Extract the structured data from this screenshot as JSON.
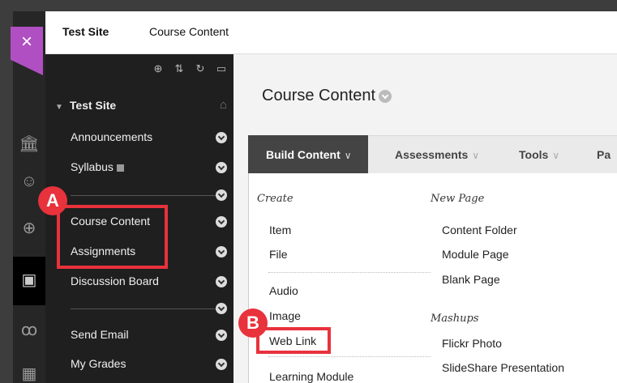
{
  "topbar": {
    "crumb_site": "Test Site",
    "crumb_page": "Course Content"
  },
  "sidebar": {
    "site_title": "Test Site",
    "items": [
      {
        "label": "Announcements"
      },
      {
        "label": "Syllabus"
      },
      {
        "label": "Course Content"
      },
      {
        "label": "Assignments"
      },
      {
        "label": "Discussion Board"
      },
      {
        "label": "Send Email"
      },
      {
        "label": "My Grades"
      }
    ]
  },
  "main": {
    "title": "Course Content",
    "actions": [
      {
        "label": "Build Content"
      },
      {
        "label": "Assessments"
      },
      {
        "label": "Tools"
      },
      {
        "label": "Pa"
      }
    ],
    "create": {
      "heading": "Create",
      "items": [
        "Item",
        "File",
        "Audio",
        "Image",
        "Web Link",
        "Learning Module"
      ]
    },
    "new_page": {
      "heading": "New Page",
      "items": [
        "Content Folder",
        "Module Page",
        "Blank Page"
      ]
    },
    "mashups": {
      "heading": "Mashups",
      "items": [
        "Flickr Photo",
        "SlideShare Presentation"
      ]
    }
  },
  "annotations": {
    "a": "A",
    "b": "B"
  },
  "colors": {
    "accent_purple": "#b04fc2",
    "highlight_red": "#e8323c"
  }
}
